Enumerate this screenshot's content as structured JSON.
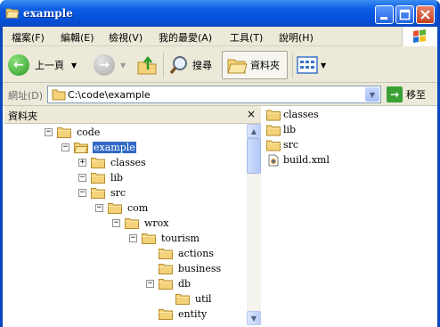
{
  "window": {
    "title": "example"
  },
  "menu": {
    "items": [
      "檔案(F)",
      "編輯(E)",
      "檢視(V)",
      "我的最愛(A)",
      "工具(T)",
      "說明(H)"
    ]
  },
  "toolbar": {
    "back_label": "上一頁",
    "search_label": "搜尋",
    "folders_label": "資料夾"
  },
  "address": {
    "label": "網址(D)",
    "value": "C:\\code\\example",
    "go_label": "移至"
  },
  "left_pane": {
    "title": "資料夾",
    "close_glyph": "×",
    "tree": [
      {
        "label": "code",
        "depth": 2,
        "expander": "−",
        "selected": false
      },
      {
        "label": "example",
        "depth": 3,
        "expander": "−",
        "selected": true
      },
      {
        "label": "classes",
        "depth": 4,
        "expander": "+",
        "selected": false
      },
      {
        "label": "lib",
        "depth": 4,
        "expander": "−",
        "selected": false
      },
      {
        "label": "src",
        "depth": 4,
        "expander": "−",
        "selected": false
      },
      {
        "label": "com",
        "depth": 5,
        "expander": "−",
        "selected": false
      },
      {
        "label": "wrox",
        "depth": 6,
        "expander": "−",
        "selected": false
      },
      {
        "label": "tourism",
        "depth": 7,
        "expander": "−",
        "selected": false
      },
      {
        "label": "actions",
        "depth": 8,
        "expander": "",
        "selected": false
      },
      {
        "label": "business",
        "depth": 8,
        "expander": "",
        "selected": false
      },
      {
        "label": "db",
        "depth": 8,
        "expander": "−",
        "selected": false
      },
      {
        "label": "util",
        "depth": 9,
        "expander": "",
        "selected": false
      },
      {
        "label": "entity",
        "depth": 8,
        "expander": "",
        "selected": false
      }
    ]
  },
  "right_pane": {
    "files": [
      {
        "name": "classes",
        "icon": "folder-icon"
      },
      {
        "name": "lib",
        "icon": "folder-icon"
      },
      {
        "name": "src",
        "icon": "folder-icon"
      },
      {
        "name": "build.xml",
        "icon": "xml-file-icon"
      }
    ]
  },
  "colors": {
    "selection": "#316ac5",
    "titlebar": "#0550d9",
    "folder": "#f3d27a"
  }
}
